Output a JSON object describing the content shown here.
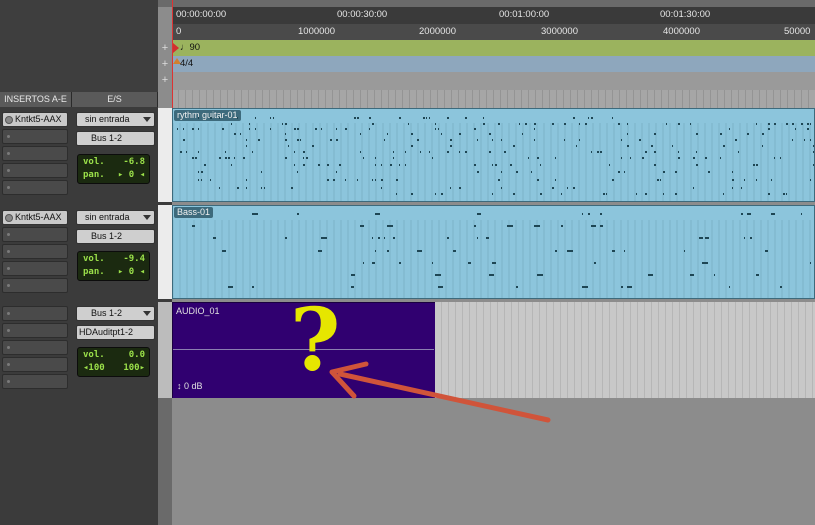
{
  "ruler": {
    "time_labels": [
      "00:00:00:00",
      "00:00:30:00",
      "00:01:00:00",
      "00:01:30:00"
    ],
    "sample_labels": [
      "0",
      "1000000",
      "2000000",
      "3000000",
      "4000000",
      "50000"
    ],
    "tempo": "90",
    "meter": "4/4",
    "add_buttons": [
      "+",
      "+",
      "+"
    ]
  },
  "headers": {
    "inserts": "INSERTOS A-E",
    "io": "E/S"
  },
  "tracks": [
    {
      "insert": "Kntkt5-AAX",
      "input": "sin entrada",
      "output": "Bus 1-2",
      "vol_label": "vol.",
      "vol": "-6.8",
      "pan_label": "pan.",
      "pan": "0",
      "clip": "rythm guitar-01"
    },
    {
      "insert": "Kntkt5-AAX",
      "input": "sin entrada",
      "output": "Bus 1-2",
      "vol_label": "vol.",
      "vol": "-9.4",
      "pan_label": "pan.",
      "pan": "0",
      "clip": "Bass-01"
    },
    {
      "input": "Bus 1-2",
      "output": "HDAuditpt1-2",
      "vol_label": "vol.",
      "vol": "0.0",
      "pan_left": "100",
      "pan_right": "100",
      "clip": "AUDIO_01",
      "clip_gain": "0 dB"
    }
  ],
  "annotation": {
    "text": "?",
    "color": "#e6e600",
    "arrow_color": "#d0543a"
  },
  "icons": [
    "plus-icon",
    "tempo-marker-icon",
    "meter-marker-icon",
    "plugin-power-icon",
    "dropdown-arrow-icon",
    "clip-gain-icon",
    "annotation-arrow"
  ]
}
